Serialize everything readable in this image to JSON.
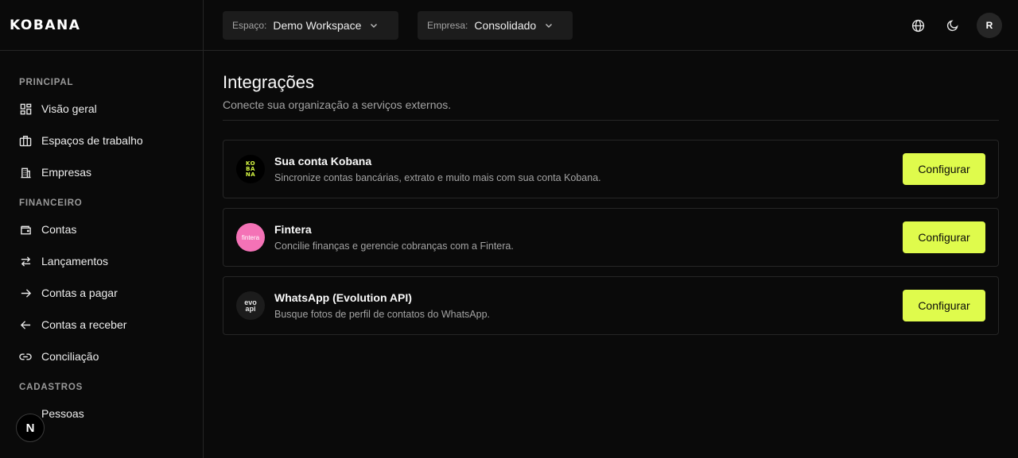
{
  "brand": {
    "logo_text": "KOBANA"
  },
  "header": {
    "workspace": {
      "label": "Espaço:",
      "value": "Demo Workspace"
    },
    "company": {
      "label": "Empresa:",
      "value": "Consolidado"
    },
    "avatar_initial": "R"
  },
  "sidebar": {
    "sections": [
      {
        "label": "PRINCIPAL",
        "items": [
          "Visão geral",
          "Espaços de trabalho",
          "Empresas"
        ]
      },
      {
        "label": "FINANCEIRO",
        "items": [
          "Contas",
          "Lançamentos",
          "Contas a pagar",
          "Contas a receber",
          "Conciliação"
        ]
      },
      {
        "label": "CADASTROS",
        "items": [
          "Pessoas"
        ]
      }
    ]
  },
  "badge_text": "N",
  "main": {
    "title": "Integrações",
    "subtitle": "Conecte sua organização a serviços externos.",
    "integrations": [
      {
        "title": "Sua conta Kobana",
        "description": "Sincronize contas bancárias, extrato e muito mais com sua conta Kobana.",
        "button": "Configurar",
        "logo_text": "KO BA NA"
      },
      {
        "title": "Fintera",
        "description": "Concilie finanças e gerencie cobranças com a Fintera.",
        "button": "Configurar",
        "logo_text": "fintera"
      },
      {
        "title": "WhatsApp (Evolution API)",
        "description": "Busque fotos de perfil de contatos do WhatsApp.",
        "button": "Configurar",
        "logo_text": "evo api"
      }
    ]
  },
  "colors": {
    "accent": "#dffb4c",
    "background": "#0a0a0a",
    "border": "#262626"
  }
}
